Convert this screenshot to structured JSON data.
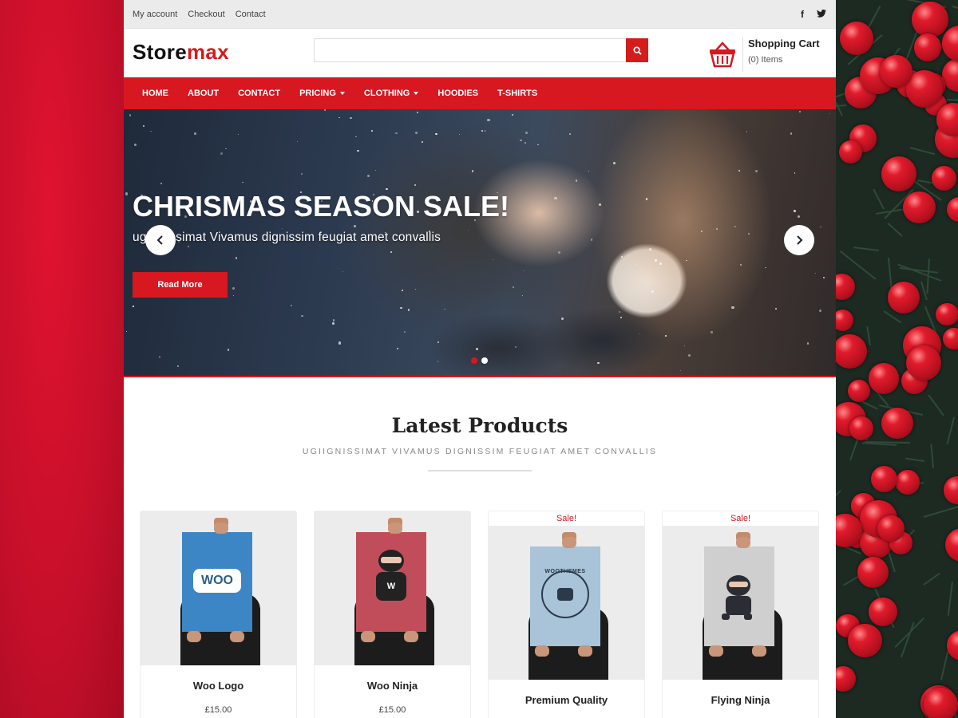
{
  "topbar": {
    "links": [
      "My account",
      "Checkout",
      "Contact"
    ],
    "social": [
      "facebook-icon",
      "twitter-icon"
    ]
  },
  "header": {
    "logo_part1": "Store",
    "logo_part2": "max",
    "search_placeholder": "",
    "cart_title": "Shopping Cart",
    "cart_count": "(0) Items"
  },
  "nav": {
    "items": [
      "HOME",
      "ABOUT",
      "CONTACT",
      "PRICING",
      "CLOTHING",
      "HOODIES",
      "T-SHIRTS"
    ]
  },
  "hero": {
    "title": "CHRISMAS SEASON SALE!",
    "subtitle": "ugiignissimat Vivamus dignissim feugiat amet convallis",
    "button": "Read More",
    "slides": 2,
    "active_slide": 1
  },
  "latest": {
    "title": "Latest Products",
    "subtitle": "UGIIGNISSIMAT VIVAMUS DIGNISSIM FEUGIAT AMET CONVALLIS"
  },
  "products": [
    {
      "name": "Woo Logo",
      "price": "£15.00",
      "sale": "",
      "poster_text": "WOO"
    },
    {
      "name": "Woo Ninja",
      "price": "£15.00",
      "sale": "",
      "poster_text": "W"
    },
    {
      "name": "Premium Quality",
      "price": "",
      "sale": "Sale!",
      "poster_text": "WOOTHEMES"
    },
    {
      "name": "Flying Ninja",
      "price": "",
      "sale": "Sale!",
      "poster_text": ""
    }
  ],
  "colors": {
    "accent": "#d71820",
    "background_left": "#c8102e",
    "topbar": "#ebebeb"
  }
}
